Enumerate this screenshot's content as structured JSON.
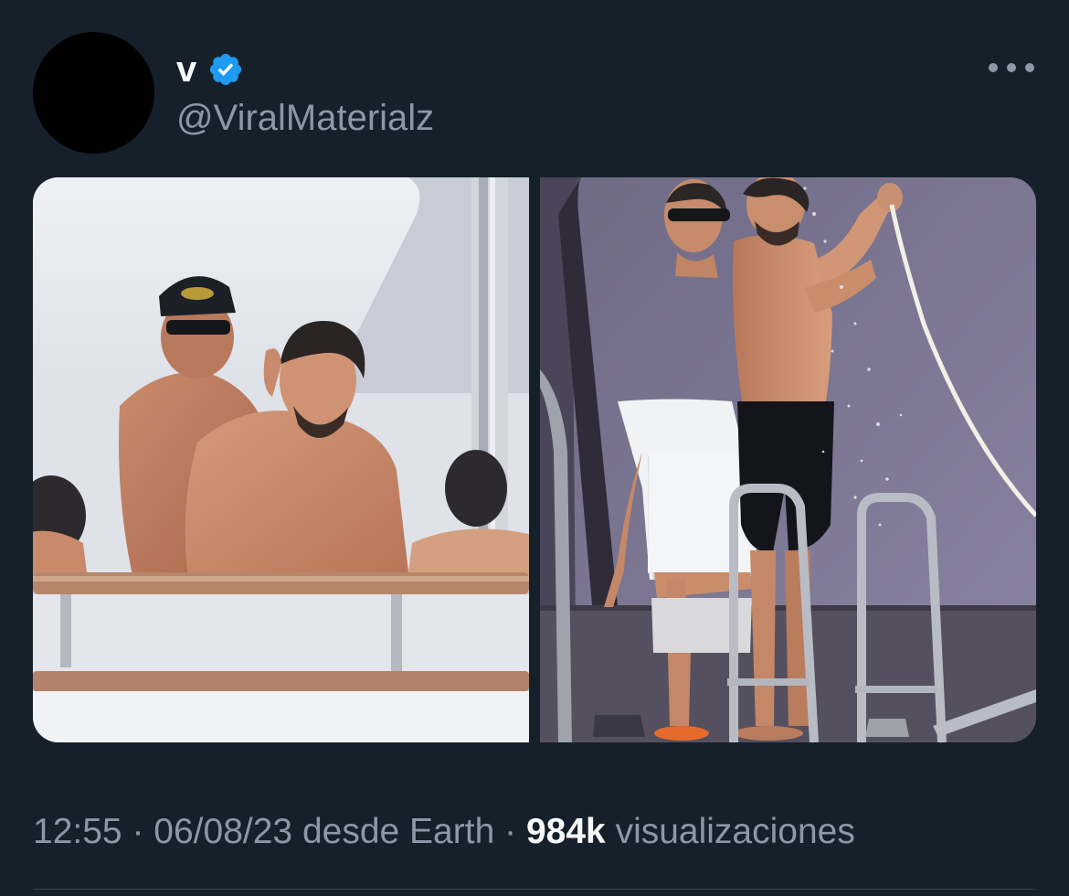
{
  "tweet": {
    "author": {
      "display_name": "v",
      "handle": "@ViralMaterialz",
      "verified": true,
      "avatar_color": "#000000"
    },
    "more_icon": "more-options-icon",
    "media": [
      {
        "icon": "photo-yacht-deck"
      },
      {
        "icon": "photo-yacht-shower"
      }
    ],
    "meta": {
      "time": "12:55",
      "date": "06/08/23",
      "source": "desde Earth",
      "views_count": "984k",
      "views_label": "visualizaciones",
      "separator": "·"
    },
    "colors": {
      "background": "#15202b",
      "primary_text": "#f7f9f9",
      "secondary_text": "#8b98a5",
      "verified_badge": "#1d9bf0"
    }
  }
}
